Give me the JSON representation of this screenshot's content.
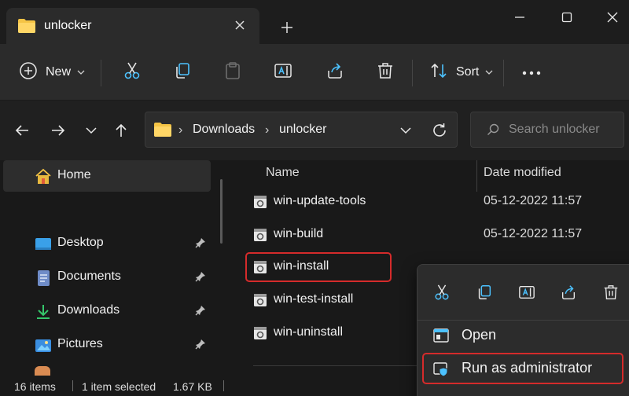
{
  "tab": {
    "title": "unlocker"
  },
  "toolbar": {
    "new_label": "New",
    "sort_label": "Sort"
  },
  "address": {
    "crumbs": [
      "Downloads",
      "unlocker"
    ]
  },
  "search": {
    "placeholder": "Search unlocker"
  },
  "sidebar": {
    "items": [
      {
        "label": "Home",
        "icon": "home-icon"
      },
      {
        "label": "Desktop",
        "icon": "desktop-icon"
      },
      {
        "label": "Documents",
        "icon": "documents-icon"
      },
      {
        "label": "Downloads",
        "icon": "downloads-icon"
      },
      {
        "label": "Pictures",
        "icon": "pictures-icon"
      }
    ]
  },
  "list": {
    "columns": {
      "name": "Name",
      "date": "Date modified"
    },
    "files": [
      {
        "name": "win-update-tools",
        "date": "05-12-2022 11:57"
      },
      {
        "name": "win-build",
        "date": "05-12-2022 11:57"
      },
      {
        "name": "win-install",
        "date": ""
      },
      {
        "name": "win-test-install",
        "date": ""
      },
      {
        "name": "win-uninstall",
        "date": ""
      }
    ]
  },
  "status": {
    "items_count": "16 items",
    "selected": "1 item selected",
    "size": "1.67 KB"
  },
  "context_menu": {
    "open_label": "Open",
    "run_admin_label": "Run as administrator"
  },
  "colors": {
    "accent": "#4cc2ff",
    "highlight_border": "#d52b2b",
    "folder": "#f5c445"
  }
}
